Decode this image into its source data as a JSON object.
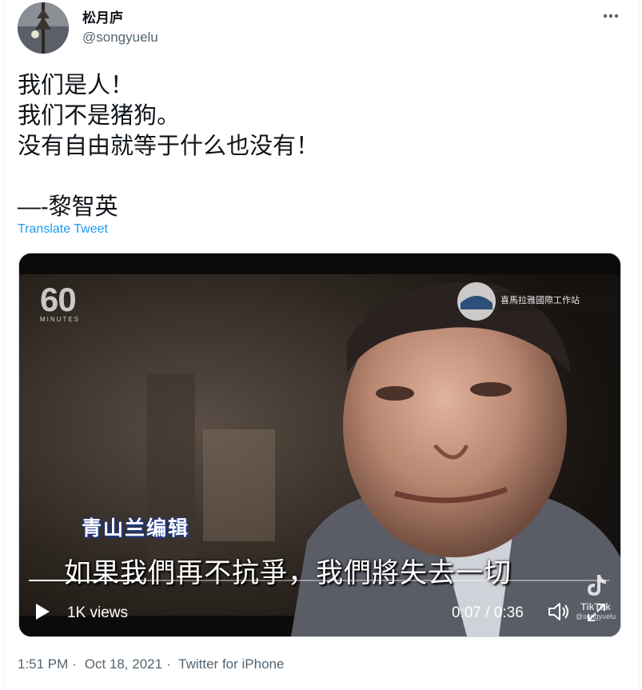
{
  "author": {
    "display_name": "松月庐",
    "handle": "@songyuelu"
  },
  "tweet": {
    "lines": [
      "我们是人！",
      "我们不是猪狗。",
      "没有自由就等于什么也没有！",
      "",
      "—-黎智英"
    ],
    "translate_label": "Translate Tweet"
  },
  "video": {
    "watermark_logo": "60",
    "watermark_sub": "MINUTES",
    "channel_badge": "青山兰编辑",
    "subtitle": "如果我們再不抗爭，我們將失去一切",
    "views": "1K views",
    "time_current": "0:07",
    "time_total": "0:36",
    "tiktok_label": "TikTok",
    "tiktok_handle": "@songyuelu",
    "corner_logo_text": "喜馬拉雅國際工作站",
    "progress": 0.19
  },
  "meta": {
    "time": "1:51 PM",
    "separator": "·",
    "date": "Oct 18, 2021",
    "source": "Twitter for iPhone"
  },
  "colors": {
    "link": "#1d9bf0",
    "secondary_text": "#536471",
    "primary_text": "#0f1419"
  },
  "icons": [
    "more-icon",
    "play-icon",
    "volume-icon",
    "fullscreen-icon",
    "tiktok-icon"
  ]
}
